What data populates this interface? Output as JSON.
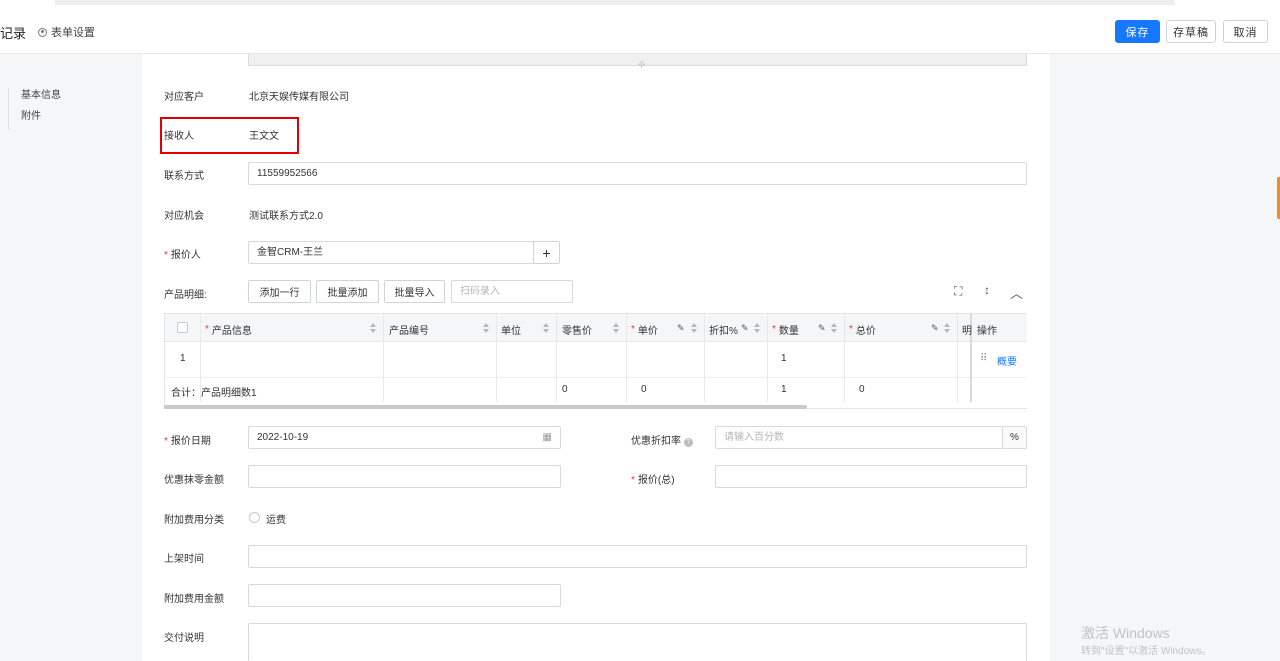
{
  "header": {
    "title": "记录",
    "settings_label": "表单设置",
    "save_label": "保存",
    "draft_label": "存草稿",
    "cancel_label": "取消"
  },
  "nav": {
    "items": [
      "基本信息",
      "附件"
    ]
  },
  "form": {
    "customer_label": "对应客户",
    "customer_value": "北京天娱传媒有限公司",
    "receiver_label": "接收人",
    "receiver_value": "王文文",
    "contact_label": "联系方式",
    "contact_value": "11559952566",
    "opportunity_label": "对应机会",
    "opportunity_value": "测试联系方式2.0",
    "quoter_label": "报价人",
    "quoter_value": "金智CRM-王兰",
    "products_label": "产品明细:",
    "add_row_label": "添加一行",
    "batch_add_label": "批量添加",
    "batch_import_label": "批量导入",
    "scan_placeholder": "扫码录入",
    "quote_date_label": "报价日期",
    "quote_date_value": "2022-10-19",
    "discount_rate_label": "优惠折扣率",
    "discount_rate_placeholder": "请输入百分数",
    "discount_rate_unit": "%",
    "rounding_label": "优惠抹零金额",
    "total_quote_label": "报价(总)",
    "extra_fee_type_label": "附加费用分类",
    "extra_fee_option": "运费",
    "shelf_time_label": "上架时间",
    "extra_fee_amount_label": "附加费用金额",
    "delivery_label": "交付说明"
  },
  "table": {
    "columns": [
      "产品信息",
      "产品编号",
      "单位",
      "零售价",
      "单价",
      "折扣%",
      "数量",
      "总价",
      "明",
      "操作"
    ],
    "row": {
      "index": "1",
      "quantity": "1",
      "action": "概要"
    },
    "summary": {
      "label": "合计：产品明细数1",
      "retail": "0",
      "unit_price": "0",
      "quantity": "1",
      "total": "0"
    }
  },
  "watermark": {
    "line1": "激活 Windows",
    "line2": "转到\"设置\"以激活 Windows。"
  },
  "colors": {
    "primary": "#1677ff",
    "highlight_box": "#e00000",
    "required": "#e53935",
    "link": "#1677ff"
  }
}
